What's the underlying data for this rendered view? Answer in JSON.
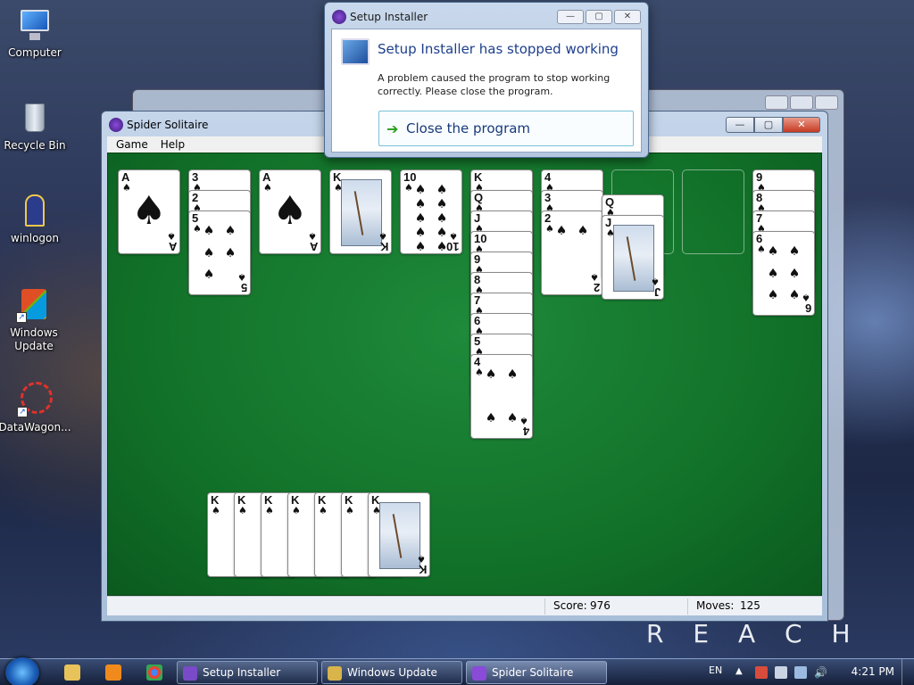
{
  "desktop": {
    "icons": [
      {
        "label": "Computer"
      },
      {
        "label": "Recycle Bin"
      },
      {
        "label": "winlogon"
      },
      {
        "label": "Windows Update"
      },
      {
        "label": "DataWagon..."
      }
    ],
    "wallpaper_text": "R E A C H"
  },
  "solitaire": {
    "title": "Spider Solitaire",
    "menu": [
      "Game",
      "Help"
    ],
    "controls": {
      "minimize": "—",
      "maximize": "▢",
      "close": "✕"
    },
    "status": {
      "score_label": "Score:",
      "score": "976",
      "moves_label": "Moves:",
      "moves": "125"
    },
    "suit": "♠",
    "tableau": [
      {
        "column": 1,
        "cards": [
          "A"
        ]
      },
      {
        "column": 2,
        "cards": [
          "3",
          "2",
          "5"
        ]
      },
      {
        "column": 3,
        "cards": [
          "A"
        ]
      },
      {
        "column": 4,
        "cards": [
          "K"
        ]
      },
      {
        "column": 5,
        "cards": [
          "10"
        ]
      },
      {
        "column": 6,
        "cards": [
          "K",
          "Q",
          "J",
          "10",
          "9",
          "8",
          "7",
          "6",
          "5",
          "4"
        ]
      },
      {
        "column": 7,
        "cards": [
          "4",
          "3",
          "2"
        ]
      },
      {
        "column": 8,
        "cards": []
      },
      {
        "column": 9,
        "cards": []
      },
      {
        "column": 10,
        "cards": [
          "9",
          "8",
          "7",
          "6"
        ]
      }
    ],
    "dragging": [
      "Q",
      "J"
    ],
    "completed": [
      "K",
      "K",
      "K",
      "K",
      "K",
      "K",
      "K"
    ]
  },
  "dialog": {
    "title": "Setup Installer",
    "heading": "Setup Installer has stopped working",
    "message": "A problem caused the program to stop working correctly. Please close the program.",
    "action": "Close the program",
    "controls": {
      "minimize": "—",
      "maximize": "▢",
      "close": "✕"
    }
  },
  "taskbar": {
    "buttons": [
      {
        "label": "Setup Installer"
      },
      {
        "label": "Windows Update"
      },
      {
        "label": "Spider Solitaire"
      }
    ],
    "language": "EN",
    "clock": "4:21 PM"
  },
  "colors": {
    "felt": "#117028",
    "dialog_heading": "#1d3f8c",
    "close_button": "#c53a22"
  }
}
